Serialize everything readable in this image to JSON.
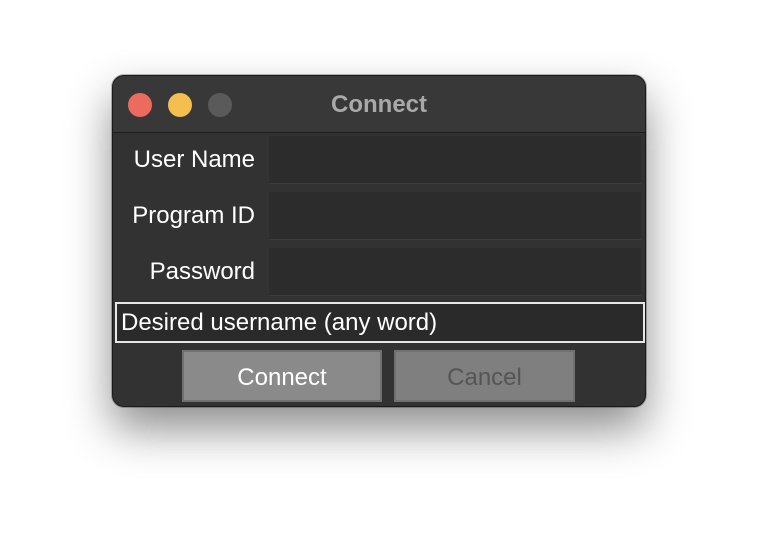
{
  "window": {
    "title": "Connect"
  },
  "form": {
    "user_name_label": "User Name",
    "user_name_value": "",
    "program_id_label": "Program ID",
    "program_id_value": "",
    "password_label": "Password",
    "password_value": "",
    "hint_text": "Desired username (any word)"
  },
  "buttons": {
    "connect_label": "Connect",
    "cancel_label": "Cancel"
  },
  "colors": {
    "close_button": "#ed6a5e",
    "minimize_button": "#f4bf4f",
    "zoom_button": "#5a5a5a"
  }
}
